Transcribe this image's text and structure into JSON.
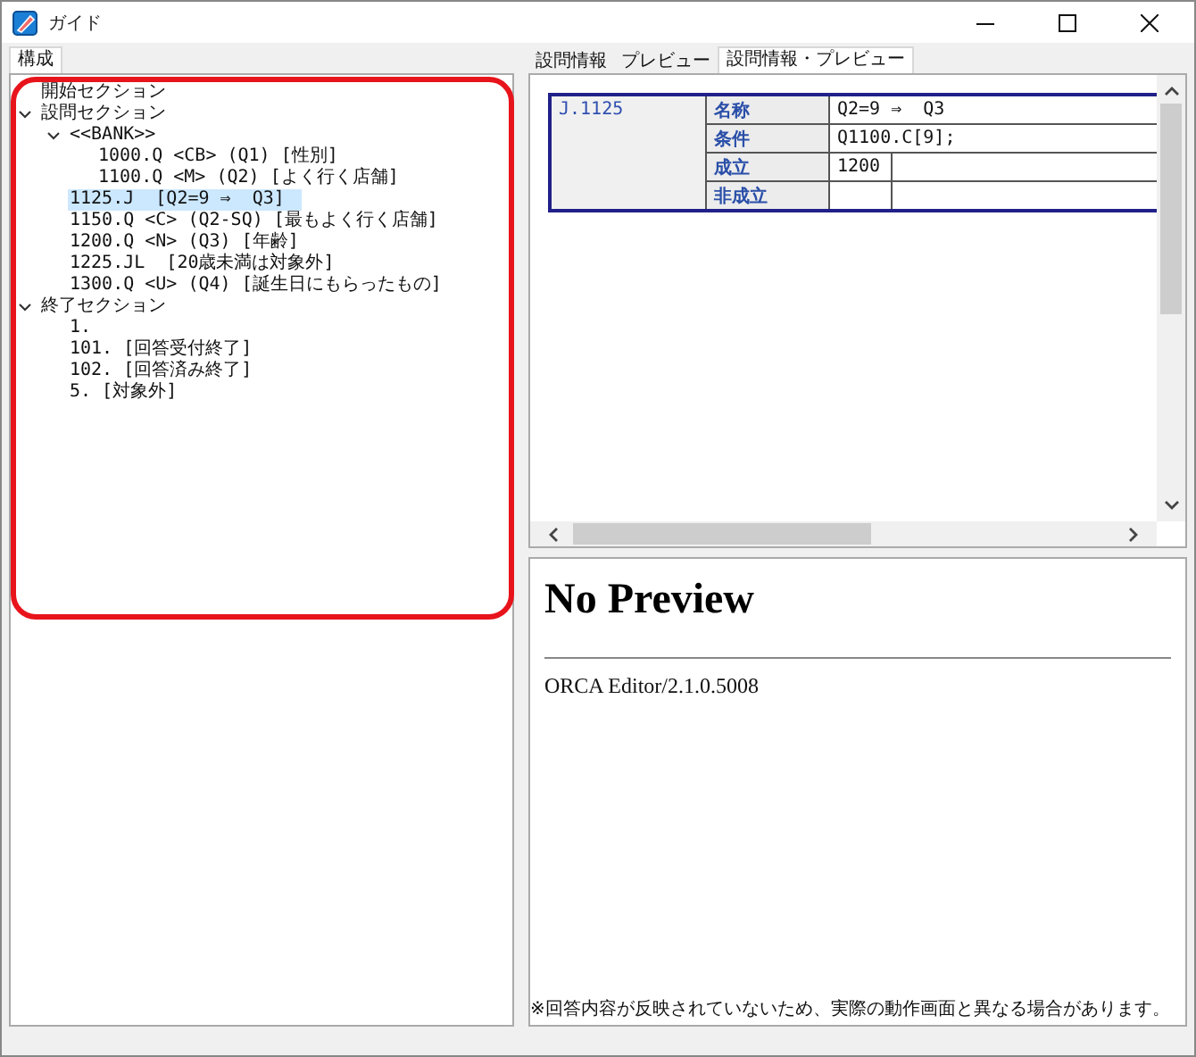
{
  "window": {
    "title": "ガイド"
  },
  "left_tabs": [
    {
      "label": "構成",
      "selected": true
    }
  ],
  "tree": [
    {
      "label": "開始セクション",
      "selected": false
    },
    {
      "label": "設問セクション",
      "selected": false,
      "expanded": true,
      "children": [
        {
          "label": "<<BANK>>",
          "selected": false,
          "expanded": true,
          "children": [
            {
              "label": "1000.Q <CB> (Q1) [性別]",
              "selected": false
            },
            {
              "label": "1100.Q <M> (Q2) [よく行く店舗]",
              "selected": false
            }
          ]
        },
        {
          "label": "1125.J  [Q2=9 ⇒  Q3]",
          "selected": true
        },
        {
          "label": "1150.Q <C> (Q2-SQ) [最もよく行く店舗]",
          "selected": false
        },
        {
          "label": "1200.Q <N> (Q3) [年齢]",
          "selected": false
        },
        {
          "label": "1225.JL  [20歳未満は対象外]",
          "selected": false
        },
        {
          "label": "1300.Q <U> (Q4) [誕生日にもらったもの]",
          "selected": false
        }
      ]
    },
    {
      "label": "終了セクション",
      "selected": false,
      "expanded": true,
      "children": [
        {
          "label": "1.",
          "selected": false
        },
        {
          "label": "101. [回答受付終了]",
          "selected": false
        },
        {
          "label": "102. [回答済み終了]",
          "selected": false
        },
        {
          "label": "5. [対象外]",
          "selected": false
        }
      ]
    }
  ],
  "right_tabs": [
    {
      "label": "設問情報",
      "selected": false
    },
    {
      "label": "プレビュー",
      "selected": false
    },
    {
      "label": "設問情報・プレビュー",
      "selected": true
    }
  ],
  "info_table": {
    "id": "J.1125",
    "rows": [
      {
        "label": "名称",
        "value": "Q2=9 ⇒  Q3",
        "kind": "single"
      },
      {
        "label": "条件",
        "value": "Q1100.C[9];",
        "kind": "single"
      },
      {
        "label": "成立",
        "value": "1200",
        "kind": "split"
      },
      {
        "label": "非成立",
        "kind": "split"
      }
    ]
  },
  "preview": {
    "heading": "No Preview",
    "version": "ORCA Editor/2.1.0.5008",
    "note": "※回答内容が反映されていないため、実際の動作画面と異なる場合があります。"
  }
}
